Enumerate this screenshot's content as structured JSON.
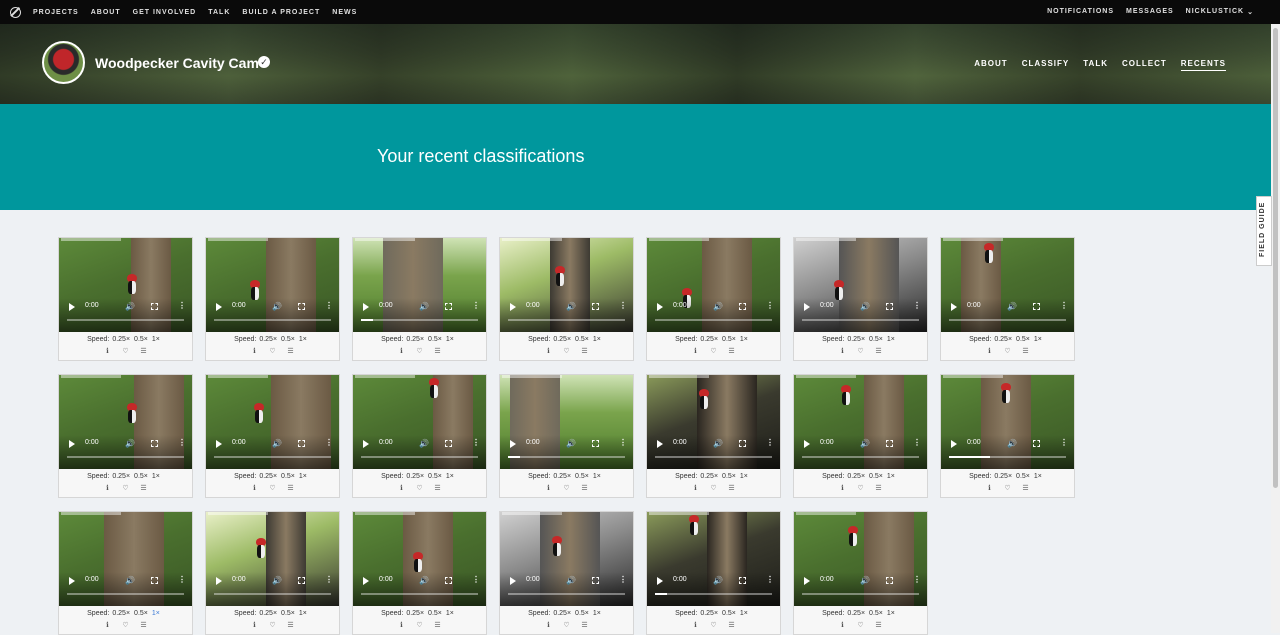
{
  "topnav": {
    "left": [
      "PROJECTS",
      "ABOUT",
      "GET INVOLVED",
      "TALK",
      "BUILD A PROJECT",
      "NEWS"
    ],
    "right": [
      "NOTIFICATIONS",
      "MESSAGES",
      "NICKLUSTICK"
    ]
  },
  "project": {
    "title": "Woodpecker Cavity Cam",
    "nav": [
      "ABOUT",
      "CLASSIFY",
      "TALK",
      "COLLECT",
      "RECENTS"
    ],
    "active_nav": "RECENTS"
  },
  "banner": {
    "heading": "Your recent classifications"
  },
  "field_guide": "FIELD GUIDE",
  "player": {
    "time": "0:00",
    "speed_label": "Speed:",
    "speed_options": [
      "0.25×",
      "0.5×",
      "1×"
    ]
  },
  "colors": {
    "banner": "#00979d",
    "selected_speed": "#3b7ad6"
  },
  "cards": [
    {
      "scene": "green",
      "progress": 0.0,
      "selected_speed": null
    },
    {
      "scene": "green",
      "progress": 0.0,
      "selected_speed": null
    },
    {
      "scene": "field",
      "progress": 0.1,
      "selected_speed": null
    },
    {
      "scene": "bright",
      "progress": 0.0,
      "selected_speed": null
    },
    {
      "scene": "green",
      "progress": 0.0,
      "selected_speed": null
    },
    {
      "scene": "gray",
      "progress": 0.0,
      "selected_speed": null
    },
    {
      "scene": "green",
      "progress": 0.0,
      "selected_speed": null
    },
    {
      "scene": "green",
      "progress": 0.0,
      "selected_speed": null
    },
    {
      "scene": "green",
      "progress": 0.0,
      "selected_speed": null
    },
    {
      "scene": "green",
      "progress": 0.0,
      "selected_speed": null
    },
    {
      "scene": "field",
      "progress": 0.1,
      "selected_speed": null
    },
    {
      "scene": "dark",
      "progress": 0.0,
      "selected_speed": null
    },
    {
      "scene": "green",
      "progress": 0.0,
      "selected_speed": null
    },
    {
      "scene": "green",
      "progress": 0.35,
      "selected_speed": null
    },
    {
      "scene": "green",
      "progress": 0.0,
      "selected_speed": "1×"
    },
    {
      "scene": "bright",
      "progress": 0.0,
      "selected_speed": null
    },
    {
      "scene": "green",
      "progress": 0.0,
      "selected_speed": null
    },
    {
      "scene": "gray",
      "progress": 0.0,
      "selected_speed": null
    },
    {
      "scene": "dark",
      "progress": 0.1,
      "selected_speed": null
    },
    {
      "scene": "green",
      "progress": 0.0,
      "selected_speed": null
    }
  ]
}
